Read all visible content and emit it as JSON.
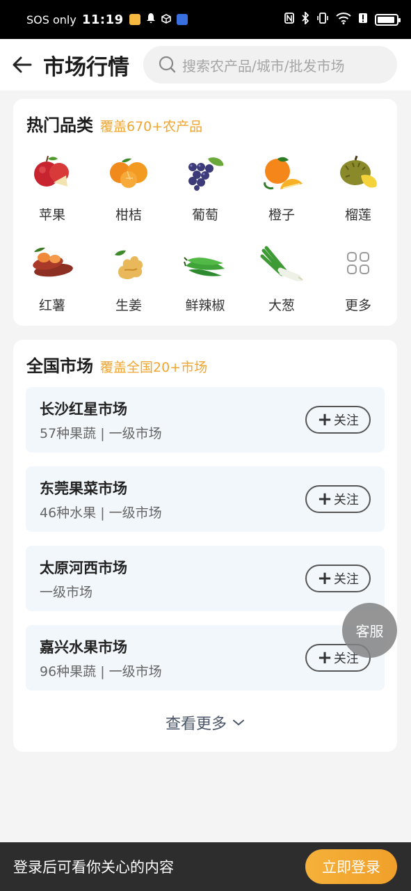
{
  "status_bar": {
    "carrier": "SOS only",
    "time": "11:19"
  },
  "header": {
    "title": "市场行情",
    "search_placeholder": "搜索农产品/城市/批发市场"
  },
  "hot_categories": {
    "title": "热门品类",
    "subtitle": "覆盖670+农产品",
    "items": [
      {
        "label": "苹果",
        "icon": "apple-icon"
      },
      {
        "label": "柑桔",
        "icon": "tangerine-icon"
      },
      {
        "label": "葡萄",
        "icon": "grape-icon"
      },
      {
        "label": "橙子",
        "icon": "orange-icon"
      },
      {
        "label": "榴莲",
        "icon": "durian-icon"
      },
      {
        "label": "红薯",
        "icon": "sweet-potato-icon"
      },
      {
        "label": "生姜",
        "icon": "ginger-icon"
      },
      {
        "label": "鲜辣椒",
        "icon": "chili-pepper-icon"
      },
      {
        "label": "大葱",
        "icon": "scallion-icon"
      },
      {
        "label": "更多",
        "icon": "grid-more-icon"
      }
    ]
  },
  "markets": {
    "title": "全国市场",
    "subtitle": "覆盖全国20+市场",
    "items": [
      {
        "name": "长沙红星市场",
        "info": "57种果蔬 | 一级市场",
        "follow": "关注"
      },
      {
        "name": "东莞果菜市场",
        "info": "46种水果 | 一级市场",
        "follow": "关注"
      },
      {
        "name": "太原河西市场",
        "info": "一级市场",
        "follow": "关注"
      },
      {
        "name": "嘉兴水果市场",
        "info": "96种果蔬 | 一级市场",
        "follow": "关注"
      }
    ],
    "view_more": "查看更多"
  },
  "float_service": "客服",
  "bottom_bar": {
    "text": "登录后可看你关心的内容",
    "login_button": "立即登录"
  },
  "colors": {
    "accent": "#f0a531",
    "card_bg": "#ffffff",
    "market_item_bg": "#f2f7fb",
    "bottom_bar_bg": "#2d2d2d"
  }
}
